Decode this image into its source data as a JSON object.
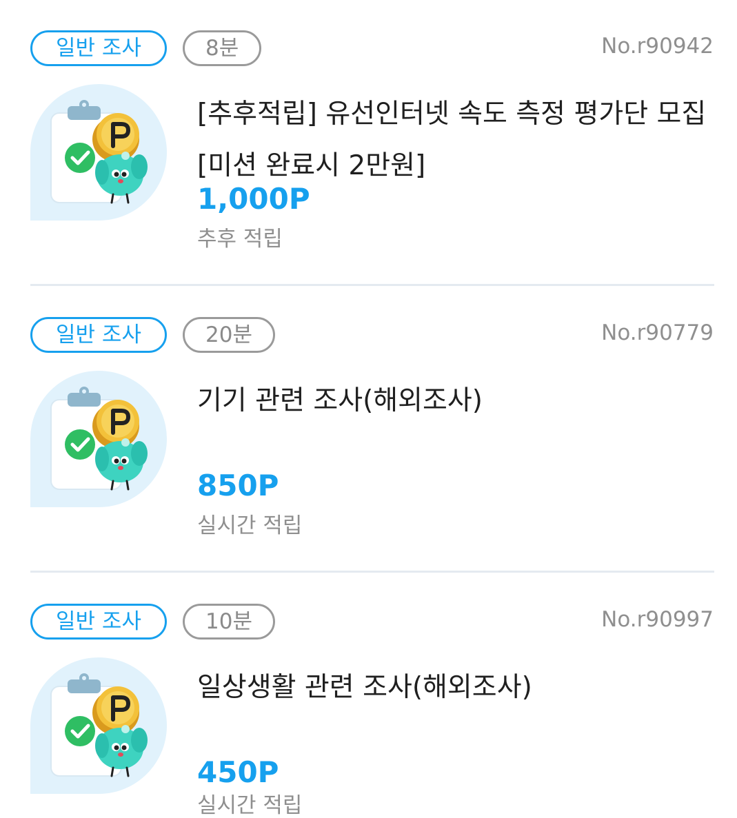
{
  "surveys": [
    {
      "type_label": "일반 조사",
      "duration": "8분",
      "survey_no": "No.r90942",
      "title": "[추후적립] 유선인터넷 속도 측정 평가단 모집 [미션 완료시 2만원]",
      "reward": "1,000P",
      "payout": "추후 적립",
      "icon": "survey-points-mascot-icon"
    },
    {
      "type_label": "일반 조사",
      "duration": "20분",
      "survey_no": "No.r90779",
      "title": "기기 관련 조사(해외조사)",
      "reward": "850P",
      "payout": "실시간 적립",
      "icon": "survey-points-mascot-icon"
    },
    {
      "type_label": "일반 조사",
      "duration": "10분",
      "survey_no": "No.r90997",
      "title": "일상생활 관련 조사(해외조사)",
      "reward": "450P",
      "payout": "실시간 적립",
      "icon": "survey-points-mascot-icon"
    }
  ],
  "colors": {
    "accent": "#16a0ee",
    "muted_text": "#8f8f8f",
    "title_text": "#1f1f1f",
    "divider": "#e4eaf0",
    "thumb_bg": "#e1f2fc"
  }
}
